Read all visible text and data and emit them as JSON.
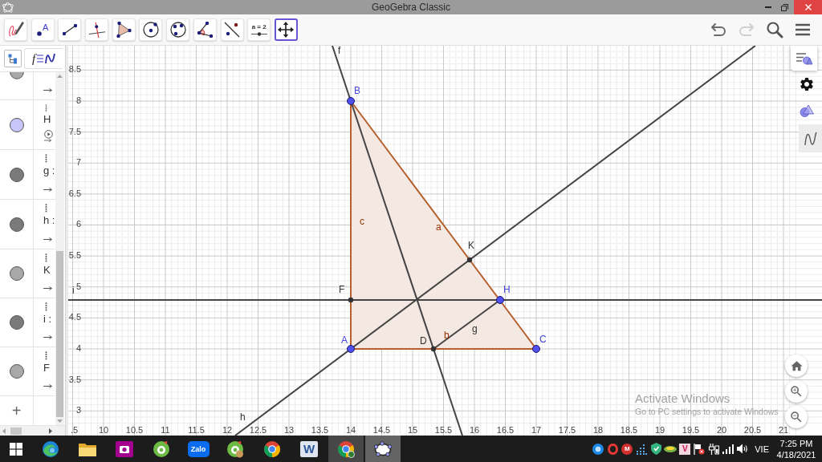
{
  "window": {
    "title": "GeoGebra Classic"
  },
  "toolbar": {
    "tools": [
      {
        "kind": "freehand",
        "selected": false
      },
      {
        "kind": "point",
        "label": "A",
        "selected": false
      },
      {
        "kind": "segment",
        "selected": false
      },
      {
        "kind": "perpendicular",
        "selected": false
      },
      {
        "kind": "polygon",
        "selected": false
      },
      {
        "kind": "circle",
        "selected": false
      },
      {
        "kind": "circle3",
        "selected": false
      },
      {
        "kind": "angle",
        "selected": false
      },
      {
        "kind": "reflect",
        "selected": false
      },
      {
        "kind": "slider",
        "label": "a = 2",
        "selected": false
      },
      {
        "kind": "move",
        "selected": true
      }
    ],
    "actions": [
      {
        "kind": "undo",
        "disabled": false
      },
      {
        "kind": "redo",
        "disabled": true
      },
      {
        "kind": "search"
      },
      {
        "kind": "menu"
      }
    ]
  },
  "algebra_view": {
    "header": {
      "style_label": "f"
    },
    "rows": [
      {
        "color": "#a9a9a9"
      },
      {
        "label": "H",
        "color": "#c6c6fa",
        "animation_control": true
      },
      {
        "label": "g :",
        "color": "#7a7a7a"
      },
      {
        "label": "h :",
        "color": "#7a7a7a"
      },
      {
        "label": "K",
        "color": "#a9a9a9"
      },
      {
        "label": "i :",
        "color": "#7a7a7a"
      },
      {
        "label": "F",
        "color": "#a9a9a9"
      }
    ],
    "add_label": "+"
  },
  "graphics": {
    "x_ticks": [
      ".5",
      "10",
      "10.5",
      "11",
      "11.5",
      "12",
      "12.5",
      "13",
      "13.5",
      "14",
      "14.5",
      "15",
      "15.5",
      "16",
      "16.5",
      "17",
      "17.5",
      "18",
      "18.5",
      "19",
      "19.5",
      "20",
      "20.5",
      "21"
    ],
    "y_ticks": [
      "8.5",
      "8",
      "7.5",
      "7",
      "6.5",
      "6",
      "5.5",
      "5",
      "4.5",
      "4",
      "3.5",
      "3"
    ],
    "points": [
      {
        "label": "B",
        "kind": "free"
      },
      {
        "label": "A",
        "kind": "free"
      },
      {
        "label": "C",
        "kind": "free"
      },
      {
        "label": "H",
        "kind": "free"
      },
      {
        "label": "D",
        "kind": "dependent"
      },
      {
        "label": "F",
        "kind": "dependent"
      },
      {
        "label": "K",
        "kind": "dependent"
      }
    ],
    "segments": [
      {
        "label": "a",
        "kind": "side"
      },
      {
        "label": "b",
        "kind": "side"
      },
      {
        "label": "c",
        "kind": "side"
      },
      {
        "label": "g",
        "kind": "segment"
      }
    ],
    "lines": [
      {
        "label": "f"
      },
      {
        "label": "h"
      },
      {
        "label": "i"
      }
    ],
    "style_bar": [
      {
        "kind": "style",
        "selected": false
      },
      {
        "kind": "settings",
        "selected": false
      },
      {
        "kind": "shapes",
        "selected": false
      },
      {
        "kind": "curve",
        "selected": true
      }
    ]
  },
  "activation_notice": {
    "title": "Activate Windows",
    "text": "Go to PC settings to activate Windows"
  },
  "taskbar": {
    "apps": [
      {
        "kind": "swirl",
        "open": false,
        "selected": false
      },
      {
        "kind": "folder",
        "open": false,
        "selected": false
      },
      {
        "kind": "camera",
        "open": false,
        "selected": false
      },
      {
        "kind": "ring",
        "open": false,
        "selected": false
      },
      {
        "kind": "chat",
        "label": "Zalo",
        "open": false,
        "selected": false
      },
      {
        "kind": "ringbadge",
        "open": false,
        "selected": false
      },
      {
        "kind": "round",
        "open": false,
        "selected": false
      },
      {
        "kind": "doc",
        "label": "W",
        "open": false,
        "selected": false
      },
      {
        "kind": "roundbadge",
        "open": true,
        "selected": false
      },
      {
        "kind": "ellipse",
        "open": true,
        "selected": true
      }
    ],
    "tray": [
      {
        "kind": "disc"
      },
      {
        "kind": "o"
      },
      {
        "kind": "badge",
        "label": "M"
      },
      {
        "kind": "dots"
      },
      {
        "kind": "shield"
      },
      {
        "kind": "leaf"
      },
      {
        "kind": "tile",
        "label": "V"
      },
      {
        "kind": "flag"
      },
      {
        "kind": "plug"
      },
      {
        "kind": "signal"
      },
      {
        "kind": "speaker"
      }
    ],
    "language": "VIE",
    "time": "7:25 PM",
    "date": "4/18/2021"
  }
}
